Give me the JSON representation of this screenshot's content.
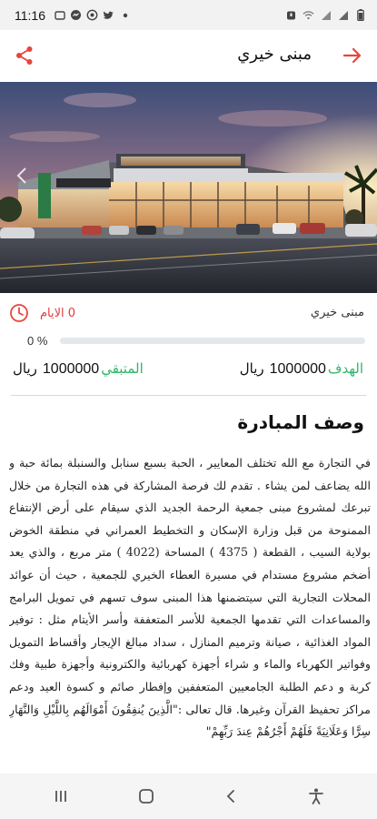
{
  "status_bar": {
    "time": "11:16",
    "left_icons": [
      "notification-icon",
      "messenger-icon",
      "whatsapp-icon",
      "twitter-icon",
      "dot-icon"
    ],
    "right_icons": [
      "alarm-icon",
      "wifi-icon",
      "signal-icon",
      "signal-icon",
      "battery-icon"
    ]
  },
  "app_bar": {
    "title": "مبنى خيري",
    "back_icon": "arrow-right-icon",
    "share_icon": "share-icon"
  },
  "initiative": {
    "name": "مبنى خيري",
    "days_left": "0 الايام",
    "progress_percent_label": "0 %",
    "progress_fraction": 0,
    "goal_label": "الهدف",
    "goal_value": "1000000",
    "remaining_label": "المتبقي",
    "remaining_value": "1000000",
    "currency": "ريال"
  },
  "description": {
    "title": "وصف المبادرة",
    "body": "في التجارة مع الله تختلف المعايير ، الحبة بسبع سنابل والسنبلة بمائة حبة و الله يضاعف لمن يشاء . تقدم لك فرصة المشاركة في هذه التجارة من خلال تبرعك لمشروع مبنى جمعية الرحمة الجديد الذي سيقام على أرض الإنتفاع الممنوحة من قبل وزارة الإسكان و التخطيط العمراني في منطقة الخوض بولاية السيب ، القطعة ( 4375 ) المساحة (4022 ) متر مربع ، والذي يعد أضخم مشروع مستدام في مسيرة العطاء الخيري للجمعية ، حيث أن عوائد المحلات التجارية التي سيتضمنها هذا المبنى سوف تسهم في تمويل البرامج والمساعدات التي تقدمها الجمعية للأسر المتعففة وأسر الأيتام مثل : توفير المواد الغذائية ، صيانة وترميم المنازل ، سداد مبالغ الإيجار وأقساط التمويل وفواتير الكهرباء والماء و شراء أجهزة كهربائية والكترونية وأجهزة طبية وفك كربة و دعم الطلبة الجامعيين المتعففين وإفطار صائم و كسوة العيد ودعم مراكز تحفيظ القرآن وغيرها. قال تعالى :\"الَّذِينَ يُنفِقُونَ أَمْوَالَهُم بِاللَّيْلِ وَالنَّهَارِ سِرًّا وَعَلَانِيَةً فَلَهُمْ أَجْرُهُمْ عِندَ رَبِّهِمْ\""
  },
  "nav_bar": {
    "icons": [
      "recent-apps-icon",
      "home-icon",
      "back-icon",
      "accessibility-icon"
    ]
  },
  "colors": {
    "accent_red": "#e8453c",
    "accent_green": "#2fb56a"
  }
}
